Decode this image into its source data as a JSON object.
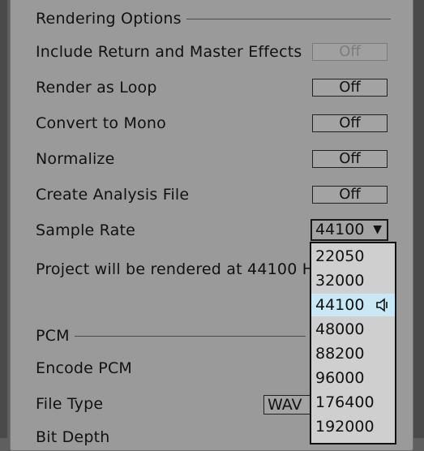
{
  "rendering_options": {
    "title": "Rendering Options",
    "rows": [
      {
        "label": "Include Return and Master Effects",
        "value": "Off",
        "disabled": true
      },
      {
        "label": "Render as Loop",
        "value": "Off",
        "disabled": false
      },
      {
        "label": "Convert to Mono",
        "value": "Off",
        "disabled": false
      },
      {
        "label": "Normalize",
        "value": "Off",
        "disabled": false
      },
      {
        "label": "Create Analysis File",
        "value": "Off",
        "disabled": false
      }
    ],
    "sample_rate": {
      "label": "Sample Rate",
      "value": "44100",
      "caret": "▼"
    },
    "note": "Project will be rendered at 44100 H"
  },
  "pcm": {
    "title": "PCM",
    "encode_label": "Encode PCM",
    "file_type_label": "File Type",
    "file_type_value": "WAV",
    "bit_depth_label": "Bit Depth"
  },
  "sample_rate_dropdown": {
    "options": [
      "22050",
      "32000",
      "44100",
      "48000",
      "88200",
      "96000",
      "176400",
      "192000"
    ],
    "selected": "44100",
    "selected_icon": "speaker-icon"
  }
}
